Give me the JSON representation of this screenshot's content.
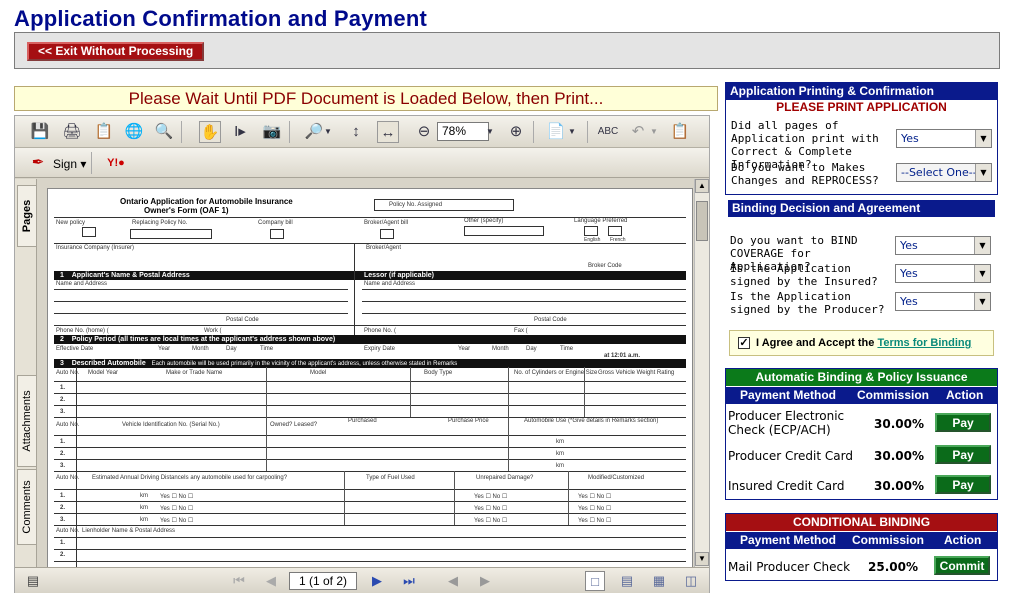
{
  "page_title": "Application Confirmation and Payment",
  "exit_button": "<< Exit Without Processing",
  "wait_message": "Please Wait Until PDF Document is Loaded Below, then Print...",
  "pdf_viewer": {
    "zoom": "78%",
    "sign_label": "Sign",
    "page_number": "1 (1 of 2)",
    "side_tabs": [
      "Pages",
      "Attachments",
      "Comments"
    ],
    "document": {
      "title_line1": "Ontario Application for Automobile Insurance",
      "title_line2": "Owner's Form (OAF 1)",
      "policy_no": "Policy No. Assigned",
      "labels": {
        "new_policy": "New policy",
        "replacing": "Replacing Policy No.",
        "company_bill": "Company bill",
        "broker_bill": "Broker/Agent bill",
        "other": "Other (specify)",
        "language": "Language Preferred",
        "english": "English",
        "french": "French",
        "insurance_company": "Insurance Company (Insurer)",
        "broker_agent": "Broker/Agent",
        "broker_code": "Broker Code",
        "name_address": "Name and Address",
        "postal_code": "Postal Code",
        "phone_home": "Phone No. (home) (",
        "work": "Work (",
        "phone_no": "Phone No. (",
        "fax": "Fax (",
        "effective_date": "Effective Date",
        "expiry_date": "Expiry Date",
        "year": "Year",
        "month": "Month",
        "day": "Day",
        "time": "Time",
        "am_pm": "at 12:01 a.m.",
        "auto_no": "Auto No.",
        "model_year": "Model Year",
        "make": "Make or Trade Name",
        "model": "Model",
        "body_type": "Body Type",
        "cylinders": "No. of Cylinders or Engine Size",
        "gvw": "Gross Vehicle Weight Rating",
        "vin": "Vehicle Identification No. (Serial No.)",
        "owned_leased": "Owned?    Leased?",
        "purchased": "Purchased",
        "purchase_price": "Purchase Price",
        "auto_use": "Automobile Use (*Give details in Remarks section)",
        "annual_distance": "Estimated Annual Driving Distance",
        "carpooling": "Is any automobile used for carpooling?",
        "fuel": "Type of Fuel Used",
        "unrepaired": "Unrepaired Damage?",
        "modified": "Modified/Customized",
        "lienholder": "Lienholder Name & Postal Address",
        "km": "km",
        "yes_no": "Yes ☐ No ☐"
      },
      "sections": [
        {
          "num": "1",
          "title": "Applicant's Name & Postal Address",
          "right": "Lessor (if applicable)"
        },
        {
          "num": "2",
          "title": "Policy Period (all times are local times at the applicant's address shown above)"
        },
        {
          "num": "3",
          "title": "Described Automobile",
          "note": "Each automobile will be used primarily in the vicinity of the applicant's address, unless otherwise stated in Remarks"
        }
      ]
    }
  },
  "printing_panel": {
    "header": "Application Printing & Confirmation",
    "subheader": "PLEASE PRINT APPLICATION",
    "q1": "Did all pages of Application print with Correct & Complete Information?",
    "q1_value": "Yes",
    "q2": "Do you want to Makes Changes and REPROCESS?",
    "q2_value": "--Select One--"
  },
  "binding_panel": {
    "header": "Binding Decision and Agreement",
    "q1": "Do you want to BIND COVERAGE for Application?",
    "q1_value": "Yes",
    "q2": "Is the Application signed by the Insured?",
    "q2_value": "Yes",
    "q3": "Is the Application signed by the Producer?",
    "q3_value": "Yes",
    "agree_prefix": "I Agree and Accept the",
    "agree_link": "Terms for Binding"
  },
  "auto_binding": {
    "header": "Automatic Binding & Policy Issuance",
    "col_method": "Payment Method",
    "col_commission": "Commission",
    "col_action": "Action",
    "rows": [
      {
        "method": "Producer Electronic Check (ECP/ACH)",
        "commission": "30.00%",
        "action": "Pay"
      },
      {
        "method": "Producer Credit Card",
        "commission": "30.00%",
        "action": "Pay"
      },
      {
        "method": "Insured Credit Card",
        "commission": "30.00%",
        "action": "Pay"
      }
    ]
  },
  "conditional_binding": {
    "header": "CONDITIONAL BINDING",
    "col_method": "Payment Method",
    "col_commission": "Commission",
    "col_action": "Action",
    "rows": [
      {
        "method": "Mail Producer Check",
        "commission": "25.00%",
        "action": "Commit"
      }
    ]
  },
  "colors": {
    "navy": "#0a1a8c",
    "green_header": "#0b7a1a",
    "red_header": "#a50f12",
    "button_green": "#0b6b1a"
  }
}
